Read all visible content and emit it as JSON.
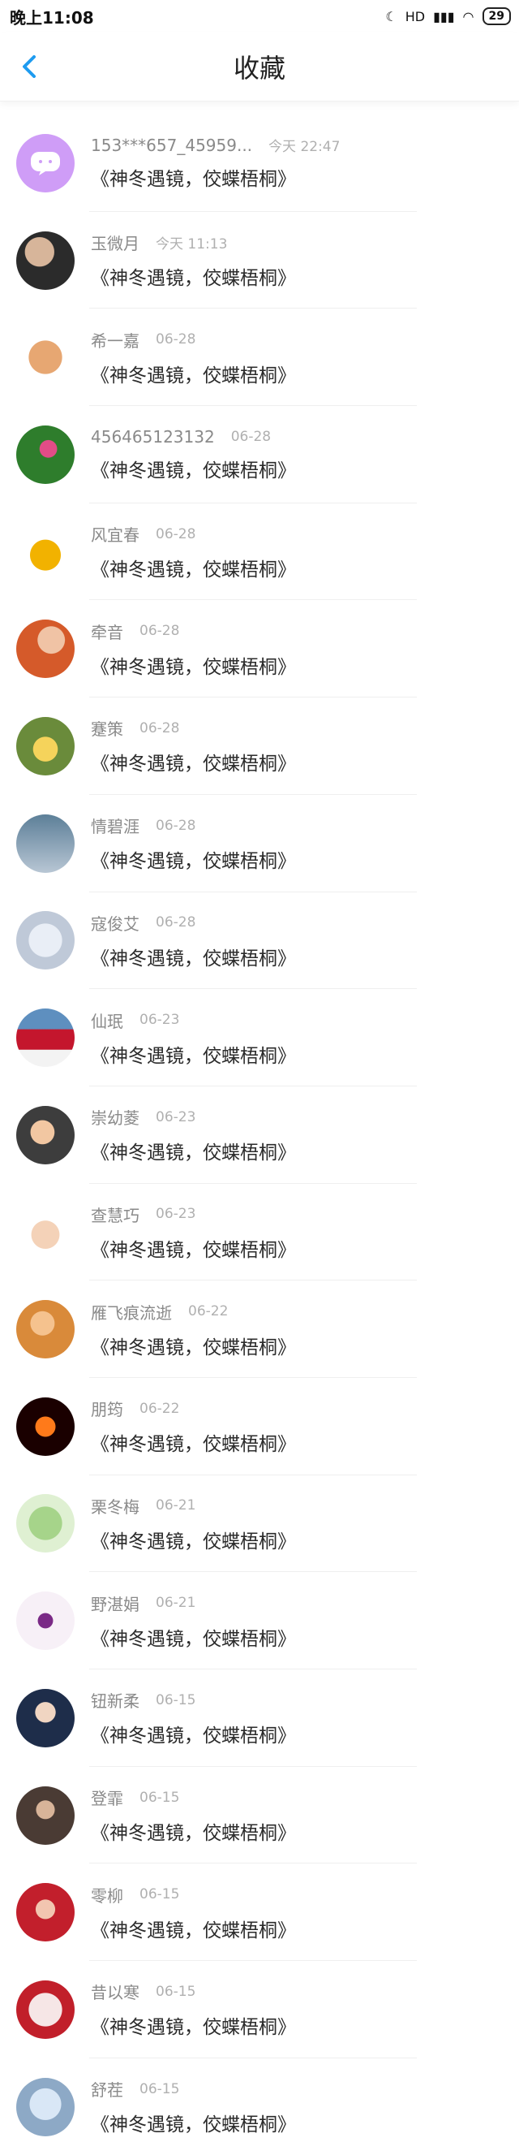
{
  "status": {
    "time": "晚上11:08",
    "hd": "HD",
    "battery": "29"
  },
  "header": {
    "title": "收藏"
  },
  "items": [
    {
      "name": "153***657_45959...",
      "time": "今天 22:47",
      "text": "《神冬遇镜，佼蝶梧桐》"
    },
    {
      "name": "玉微月",
      "time": "今天 11:13",
      "text": "《神冬遇镜，佼蝶梧桐》"
    },
    {
      "name": "希一嘉",
      "time": "06-28",
      "text": "《神冬遇镜，佼蝶梧桐》"
    },
    {
      "name": "456465123132",
      "time": "06-28",
      "text": "《神冬遇镜，佼蝶梧桐》"
    },
    {
      "name": "风宜春",
      "time": "06-28",
      "text": "《神冬遇镜，佼蝶梧桐》"
    },
    {
      "name": "牵音",
      "time": "06-28",
      "text": "《神冬遇镜，佼蝶梧桐》"
    },
    {
      "name": "蹇策",
      "time": "06-28",
      "text": "《神冬遇镜，佼蝶梧桐》"
    },
    {
      "name": "情碧涯",
      "time": "06-28",
      "text": "《神冬遇镜，佼蝶梧桐》"
    },
    {
      "name": "寇俊艾",
      "time": "06-28",
      "text": "《神冬遇镜，佼蝶梧桐》"
    },
    {
      "name": "仙珉",
      "time": "06-23",
      "text": "《神冬遇镜，佼蝶梧桐》"
    },
    {
      "name": "崇幼菱",
      "time": "06-23",
      "text": "《神冬遇镜，佼蝶梧桐》"
    },
    {
      "name": "查慧巧",
      "time": "06-23",
      "text": "《神冬遇镜，佼蝶梧桐》"
    },
    {
      "name": "雁飞痕流逝",
      "time": "06-22",
      "text": "《神冬遇镜，佼蝶梧桐》"
    },
    {
      "name": "朋筠",
      "time": "06-22",
      "text": "《神冬遇镜，佼蝶梧桐》"
    },
    {
      "name": "栗冬梅",
      "time": "06-21",
      "text": "《神冬遇镜，佼蝶梧桐》"
    },
    {
      "name": "野湛娟",
      "time": "06-21",
      "text": "《神冬遇镜，佼蝶梧桐》"
    },
    {
      "name": "钮新柔",
      "time": "06-15",
      "text": "《神冬遇镜，佼蝶梧桐》"
    },
    {
      "name": "登霏",
      "time": "06-15",
      "text": "《神冬遇镜，佼蝶梧桐》"
    },
    {
      "name": "零柳",
      "time": "06-15",
      "text": "《神冬遇镜，佼蝶梧桐》"
    },
    {
      "name": "昔以寒",
      "time": "06-15",
      "text": "《神冬遇镜，佼蝶梧桐》"
    },
    {
      "name": "舒茬",
      "time": "06-15",
      "text": "《神冬遇镜，佼蝶梧桐》"
    }
  ]
}
